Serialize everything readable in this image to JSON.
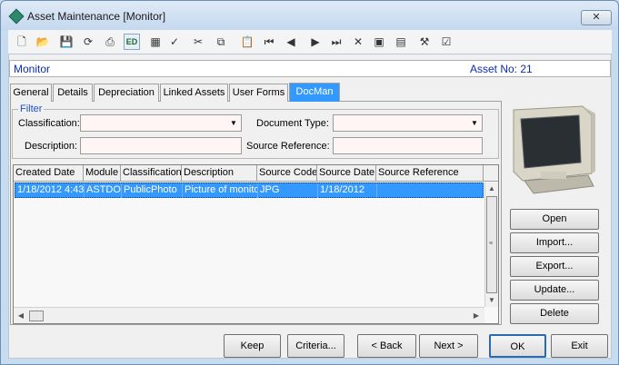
{
  "window": {
    "title": "Asset Maintenance  [Monitor]",
    "close_label": "✕"
  },
  "toolbar": {
    "icons": [
      "new-icon",
      "open-folder-icon",
      "save-icon",
      "refresh-icon",
      "print-icon",
      "edit-icon",
      "calculator-icon",
      "spellcheck-icon",
      "cut-icon",
      "copy-icon",
      "paste-icon",
      "first-record-icon",
      "previous-record-icon",
      "next-record-icon",
      "last-record-icon",
      "delete-icon",
      "grid-icon",
      "list-icon",
      "tools-icon",
      "checklist-icon"
    ],
    "glyphs": [
      "🗋",
      "📂",
      "💾",
      "⟳",
      "⎙",
      "ED",
      "▦",
      "✓",
      "✂",
      "⧉",
      "📋",
      "⏮",
      "◀",
      "▶",
      "⏭",
      "✕",
      "▣",
      "▤",
      "⚒",
      "☑"
    ]
  },
  "header": {
    "title": "Monitor",
    "asset_no": "Asset No: 21"
  },
  "tabs": [
    {
      "label": "General"
    },
    {
      "label": "Details"
    },
    {
      "label": "Depreciation"
    },
    {
      "label": "Linked Assets"
    },
    {
      "label": "User Forms"
    },
    {
      "label": "DocMan"
    }
  ],
  "filter": {
    "legend": "Filter",
    "classification_label": "Classification:",
    "classification_value": "",
    "document_type_label": "Document Type:",
    "document_type_value": "",
    "description_label": "Description:",
    "description_value": "",
    "source_reference_label": "Source Reference:",
    "source_reference_value": ""
  },
  "grid": {
    "columns": [
      "Created Date",
      "Module",
      "Classification",
      "Description",
      "Source Code",
      "Source Date",
      "Source Reference"
    ],
    "rows": [
      [
        "1/18/2012 4:43",
        "ASTDOC",
        "PublicPhoto",
        "Picture of monitor",
        "JPG",
        "1/18/2012",
        ""
      ]
    ]
  },
  "side_buttons": {
    "open": "Open",
    "import": "Import...",
    "export": "Export...",
    "update": "Update...",
    "delete": "Delete"
  },
  "bottom_buttons": {
    "keep": "Keep",
    "criteria": "Criteria...",
    "back": "< Back",
    "next": "Next >",
    "ok": "OK",
    "exit": "Exit"
  }
}
